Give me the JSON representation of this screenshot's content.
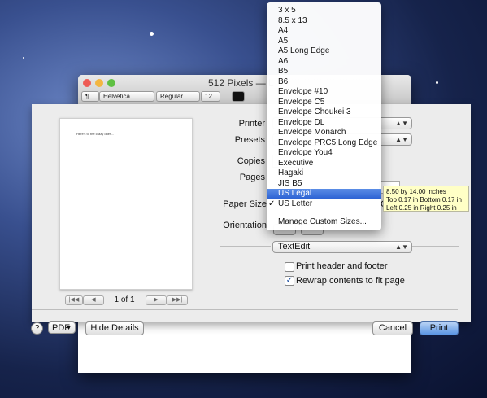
{
  "window": {
    "title": "512 Pixels — L",
    "format_buttons": [
      "¶",
      "Helvetica",
      "Regular",
      "12"
    ]
  },
  "print": {
    "preview_text": "Here's to the crazy ones...",
    "page_indicator": "1 of 1",
    "printer_label": "Printer",
    "printer_value": "",
    "presets_label": "Presets",
    "presets_value": "",
    "copies_label": "Copies",
    "pages_label": "Pages",
    "paper_size_label": "Paper Size",
    "paper_size_value": "US Letter",
    "orientation_label": "Orientation",
    "section_popup": "TextEdit",
    "print_header_footer": "Print header and footer",
    "rewrap_contents": "Rewrap contents to fit page",
    "print_header_footer_checked": false,
    "rewrap_contents_checked": true,
    "pdf_button": "PDF",
    "hide_details_button": "Hide Details",
    "cancel_button": "Cancel",
    "print_button": "Print"
  },
  "paper_menu": {
    "items": [
      "3 x 5",
      "8.5 x 13",
      "A4",
      "A5",
      "A5 Long Edge",
      "A6",
      "B5",
      "B6",
      "Envelope #10",
      "Envelope C5",
      "Envelope Choukei 3",
      "Envelope DL",
      "Envelope Monarch",
      "Envelope PRC5 Long Edge",
      "Envelope You4",
      "Executive",
      "Hagaki",
      "JIS B5",
      "US Legal",
      "US Letter"
    ],
    "highlighted": "US Legal",
    "checked": "US Letter",
    "manage": "Manage Custom Sizes..."
  },
  "tooltip": {
    "line1": "8.50 by 14.00 inches",
    "line2": "Top 0.17 in Bottom 0.17 in",
    "line3": "Left 0.25 in Right 0.25 in"
  },
  "colors": {
    "accent": "#3b6fd8",
    "menu_highlight": "#2d63d4",
    "tooltip_bg": "#ffffc6"
  }
}
